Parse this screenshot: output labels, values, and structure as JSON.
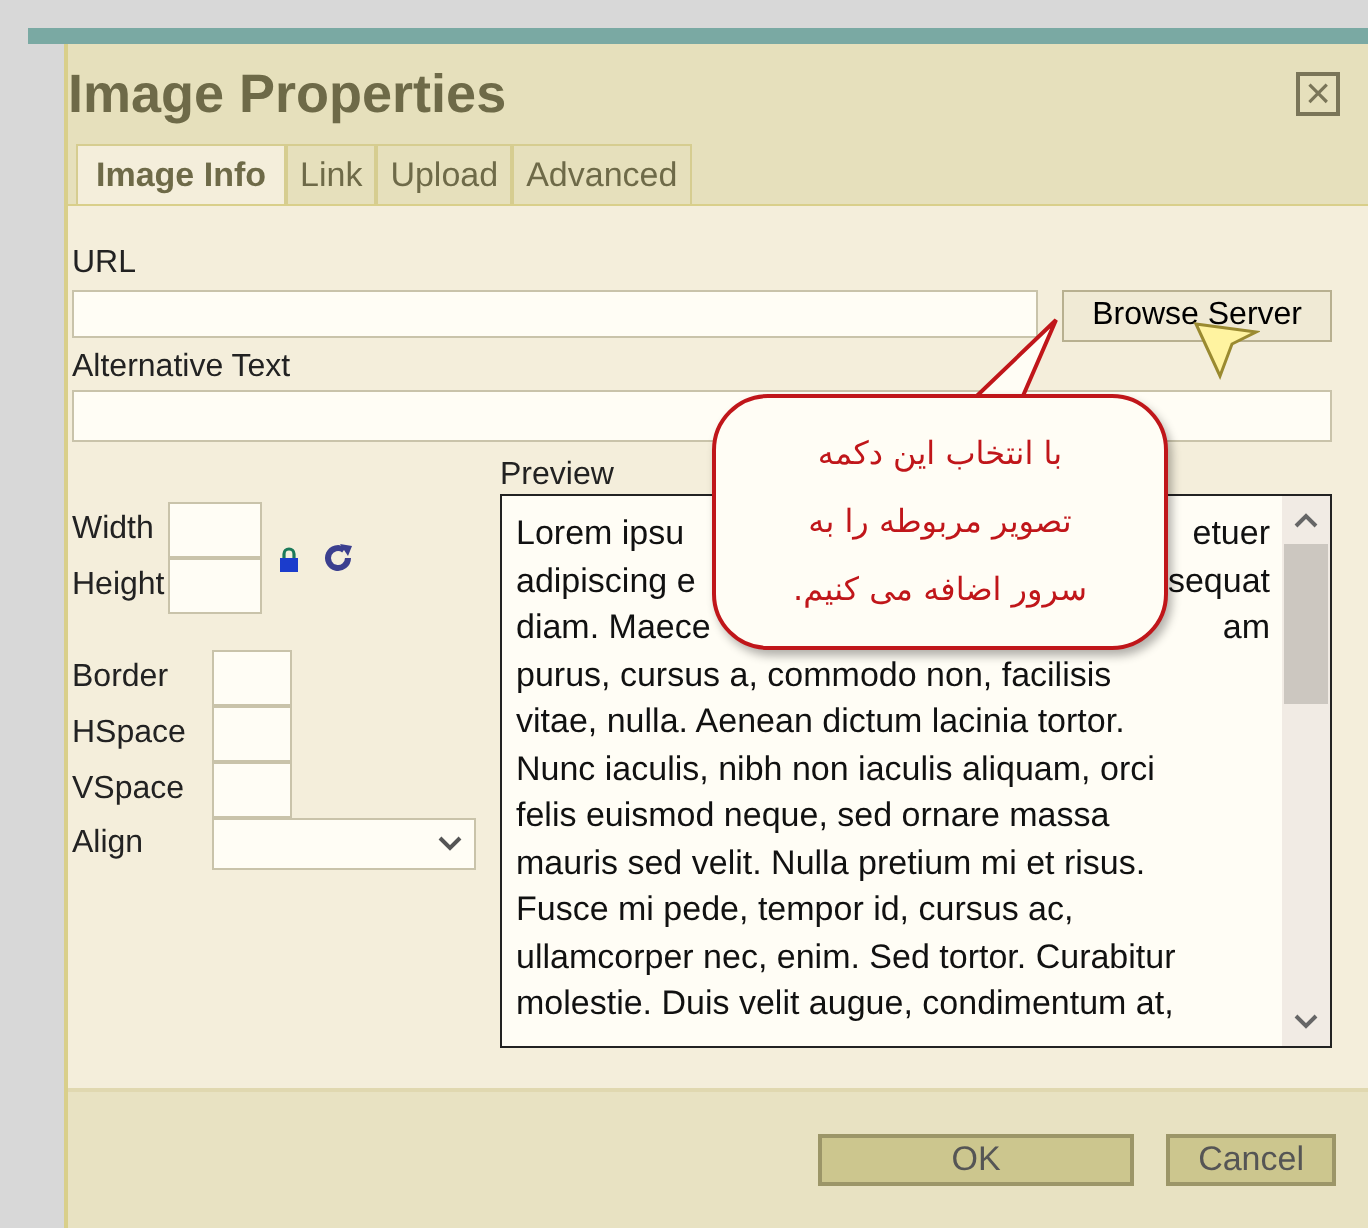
{
  "dialog": {
    "title": "Image Properties",
    "close": "×"
  },
  "tabs": [
    {
      "label": "Image Info",
      "selected": true
    },
    {
      "label": "Link",
      "selected": false
    },
    {
      "label": "Upload",
      "selected": false
    },
    {
      "label": "Advanced",
      "selected": false
    }
  ],
  "url": {
    "label": "URL",
    "browse_button": "Browse Server"
  },
  "alt_text": {
    "label": "Alternative Text"
  },
  "size_fields": [
    {
      "label": "Width"
    },
    {
      "label": "Height"
    }
  ],
  "spacing_fields": [
    {
      "label": "Border"
    },
    {
      "label": "HSpace"
    },
    {
      "label": "VSpace"
    }
  ],
  "align": {
    "label": "Align"
  },
  "preview": {
    "label": "Preview",
    "lines": [
      {
        "left": "Lorem ipsu",
        "right": "etuer"
      },
      {
        "left": "adipiscing e",
        "right": "sequat"
      },
      {
        "left": "diam. Maece",
        "right": "am"
      },
      {
        "text": "purus, cursus a, commodo non, facilisis"
      },
      {
        "text": "vitae, nulla. Aenean dictum lacinia tortor."
      },
      {
        "text": "Nunc iaculis, nibh non iaculis aliquam, orci"
      },
      {
        "text": "felis euismod neque, sed ornare massa"
      },
      {
        "text": "mauris sed velit. Nulla pretium mi et risus."
      },
      {
        "text": "Fusce mi pede, tempor id, cursus ac,"
      },
      {
        "text": "ullamcorper nec, enim. Sed tortor. Curabitur"
      },
      {
        "text": "molestie. Duis velit augue, condimentum at,"
      }
    ]
  },
  "callout": {
    "lines": [
      "با انتخاب این دکمه",
      "تصویر مربوطه را به",
      "سرور اضافه می کنیم."
    ]
  },
  "buttons": [
    {
      "label": "OK",
      "kind": "primary"
    },
    {
      "label": "Cancel",
      "kind": "secondary"
    }
  ]
}
